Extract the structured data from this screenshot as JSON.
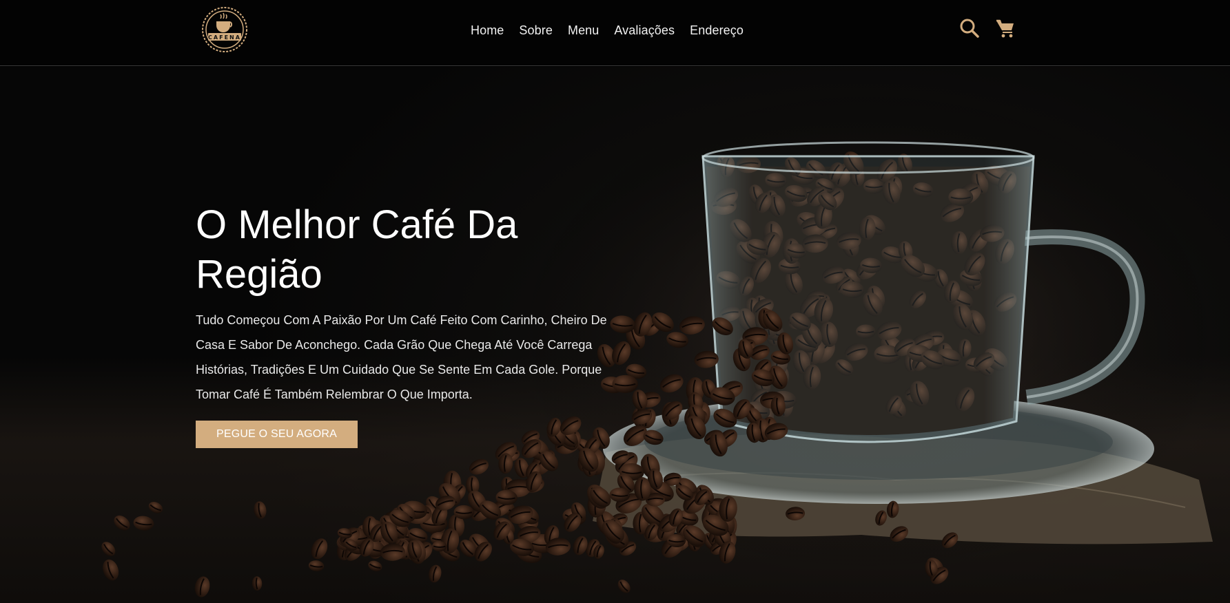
{
  "brand": {
    "logo_text": "CAFENA",
    "accent": "#d3ad7f"
  },
  "nav": {
    "items": [
      {
        "label": "Home"
      },
      {
        "label": "Sobre"
      },
      {
        "label": "Menu"
      },
      {
        "label": "Avaliações"
      },
      {
        "label": "Endereço"
      }
    ]
  },
  "header_icons": {
    "search": "search-icon",
    "cart": "cart-icon"
  },
  "hero": {
    "title": "O Melhor Café Da Região",
    "text": "Tudo Começou Com A Paixão Por Um Café Feito Com Carinho, Cheiro De Casa E Sabor De Aconchego. Cada Grão Que Chega Até Você Carrega Histórias, Tradições E Um Cuidado Que Se Sente Em Cada Gole. Porque Tomar Café É Também Relembrar O Que Importa.",
    "button_label": "PEGUE O SEU AGORA",
    "background": "coffee-beans-glass-cup-photo"
  }
}
